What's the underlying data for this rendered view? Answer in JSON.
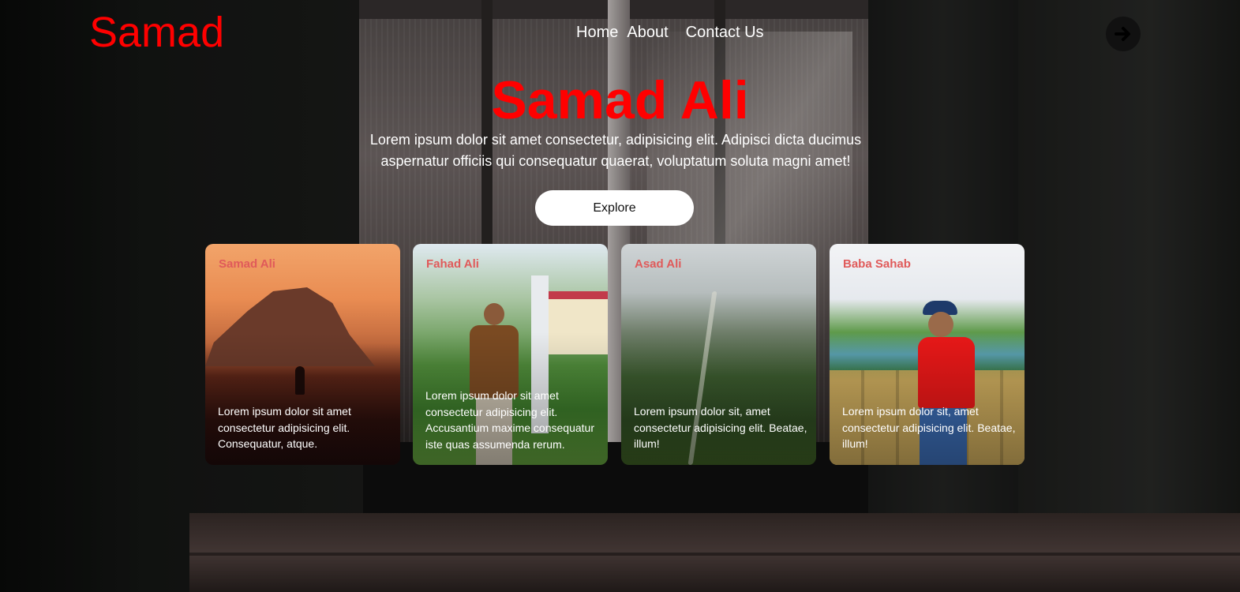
{
  "header": {
    "logo": "Samad",
    "nav": [
      {
        "label": "Home"
      },
      {
        "label": "About"
      },
      {
        "label": "Contact Us"
      }
    ]
  },
  "hero": {
    "title": "Samad Ali",
    "text": "Lorem ipsum dolor sit amet consectetur, adipisicing elit. Adipisci dicta ducimus aspernatur officiis qui consequatur quaerat, voluptatum soluta magni amet!",
    "button_label": "Explore"
  },
  "cards": [
    {
      "title": "Samad Ali",
      "text": "Lorem ipsum dolor sit amet consectetur adipisicing elit. Consequatur, atque."
    },
    {
      "title": "Fahad Ali",
      "text": "Lorem ipsum dolor sit amet consectetur adipisicing elit. Accusantium maxime consequatur iste quas assumenda rerum."
    },
    {
      "title": "Asad Ali",
      "text": "Lorem ipsum dolor sit, amet consectetur adipisicing elit. Beatae, illum!"
    },
    {
      "title": "Baba Sahab",
      "text": "Lorem ipsum dolor sit, amet consectetur adipisicing elit. Beatae, illum!"
    }
  ],
  "icons": {
    "nav_arrow": "arrow-right-circle-icon"
  },
  "colors": {
    "accent": "#ff0000",
    "card_title": "#e05a5a",
    "button_bg": "#ffffff"
  }
}
